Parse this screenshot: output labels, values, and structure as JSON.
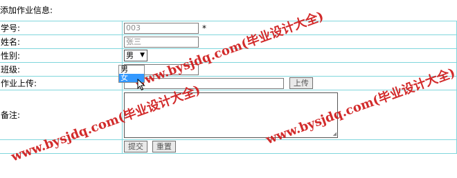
{
  "page": {
    "title": "添加作业信息:"
  },
  "form": {
    "rows": [
      {
        "label": "学号:",
        "value": "003",
        "required": "*"
      },
      {
        "label": "姓名:",
        "value": "张三"
      },
      {
        "label": "性别:",
        "value": "男"
      },
      {
        "label": "班级:",
        "value": ""
      },
      {
        "label": "作业上传:",
        "value": "",
        "button": "上传"
      },
      {
        "label": "备注:",
        "value": ""
      }
    ],
    "gender_options": [
      "男",
      "女"
    ],
    "buttons": {
      "submit": "提交",
      "reset": "重置"
    }
  },
  "watermark": {
    "text": "www.bysjdq.com(毕业设计大全)"
  },
  "colors": {
    "grid": "#7fd6dc",
    "watermark": "#d02020",
    "selected": "#3399ff"
  }
}
